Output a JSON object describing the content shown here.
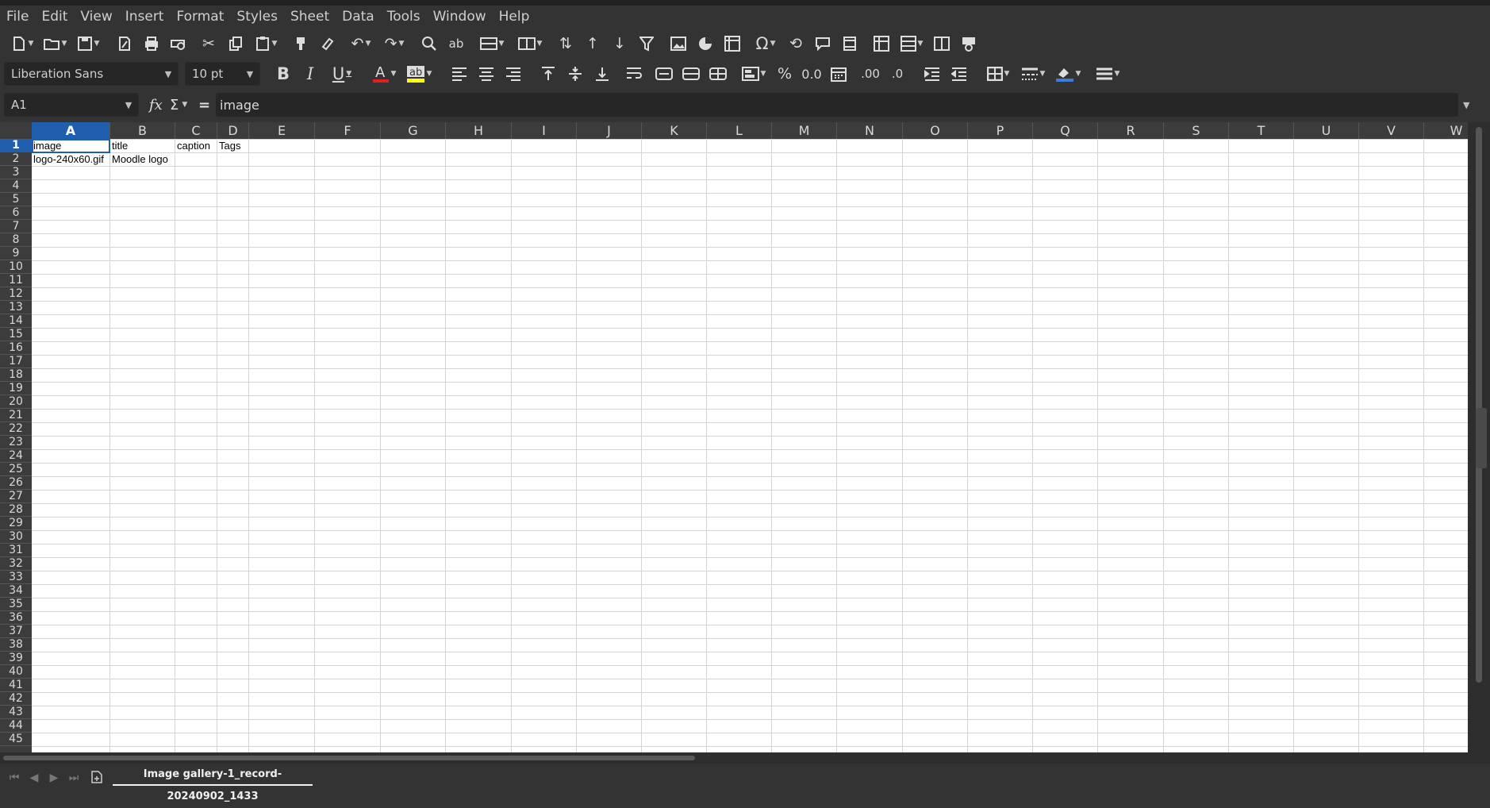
{
  "menu": [
    "File",
    "Edit",
    "View",
    "Insert",
    "Format",
    "Styles",
    "Sheet",
    "Data",
    "Tools",
    "Window",
    "Help"
  ],
  "font": {
    "name": "Liberation Sans",
    "size": "10 pt"
  },
  "formula_bar": {
    "cell_ref": "A1",
    "content": "image"
  },
  "columns": [
    "A",
    "B",
    "C",
    "D",
    "E",
    "F",
    "G",
    "H",
    "I",
    "J",
    "K",
    "L",
    "M",
    "N",
    "O",
    "P",
    "Q",
    "R",
    "S",
    "T",
    "U",
    "V",
    "W"
  ],
  "rows": [
    "1",
    "2",
    "3",
    "4",
    "5",
    "6",
    "7",
    "8",
    "9",
    "10",
    "11",
    "12",
    "13",
    "14",
    "15",
    "16",
    "17",
    "18",
    "19",
    "20",
    "21",
    "22",
    "23",
    "24",
    "25",
    "26",
    "27",
    "28",
    "29",
    "30",
    "31",
    "32",
    "33",
    "34",
    "35",
    "36",
    "37",
    "38",
    "39",
    "40",
    "41",
    "42",
    "43",
    "44",
    "45"
  ],
  "cells": {
    "A1": "image",
    "B1": "title",
    "C1": "caption",
    "D1": "Tags",
    "A2": "logo-240x60.gif",
    "B2": "Moodle logo"
  },
  "sheet_tab": "Image gallery-1_record-20240902_1433",
  "colors": {
    "selection": "#1f5fae",
    "font_color_underline": "#e02020",
    "highlight": "#ffff00"
  }
}
